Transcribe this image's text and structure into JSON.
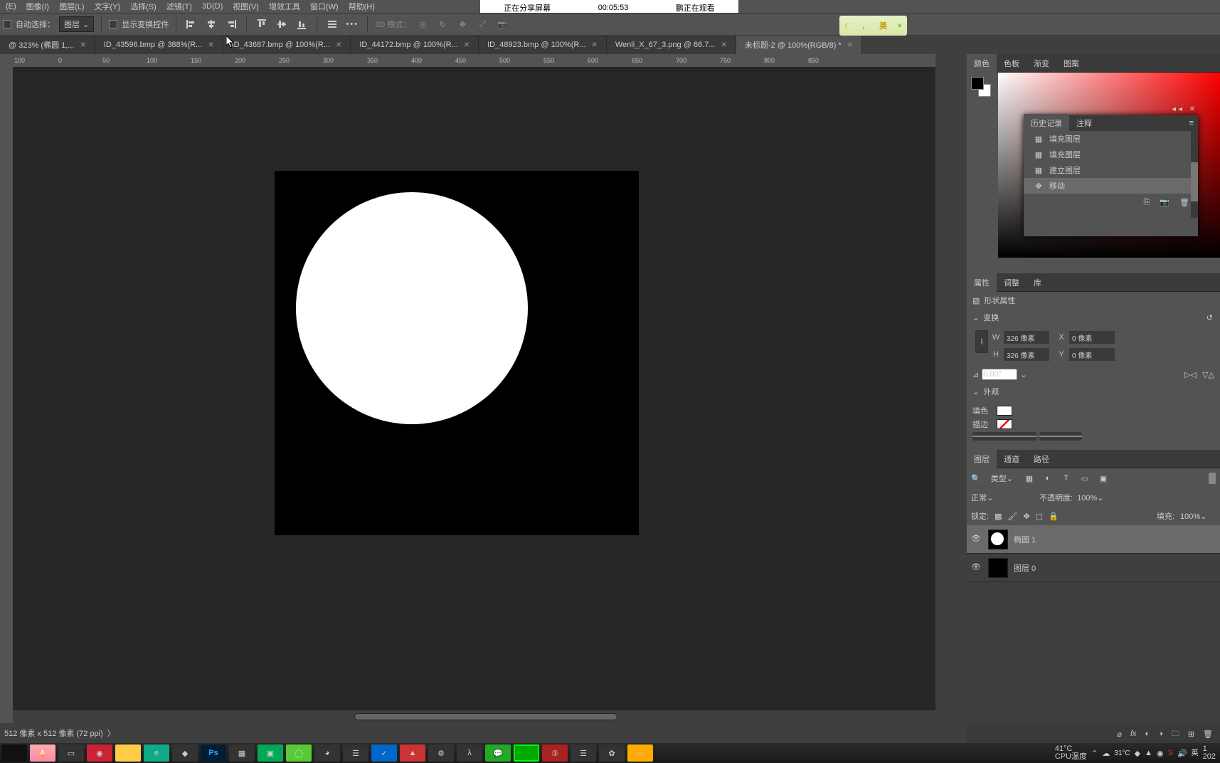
{
  "menu": [
    "(E)",
    "图像(I)",
    "图层(L)",
    "文字(Y)",
    "选择(S)",
    "滤镜(T)",
    "3D(D)",
    "视图(V)",
    "增效工具",
    "窗口(W)",
    "帮助(H)"
  ],
  "share": {
    "status": "正在分享屏幕",
    "time": "00:05:53",
    "viewer": "鹏正在观看"
  },
  "optbar": {
    "auto_select_label": "自动选择：",
    "auto_select_value": "图层",
    "show_transform_label": "显示变换控件",
    "mode3d_label": "3D 模式："
  },
  "tabs": [
    {
      "label": "@ 323% (椭圆 1,...",
      "active": false
    },
    {
      "label": "ID_43596.bmp @ 388%(R...",
      "active": false
    },
    {
      "label": "ID_43687.bmp @ 100%(R...",
      "active": false
    },
    {
      "label": "ID_44172.bmp @ 100%(R...",
      "active": false
    },
    {
      "label": "ID_48923.bmp @ 100%(R...",
      "active": false
    },
    {
      "label": "Wenli_X_67_3.png @ 66.7...",
      "active": false
    },
    {
      "label": "未标题-2 @ 100%(RGB/8) *",
      "active": true
    }
  ],
  "ruler_marks": [
    "100",
    "0",
    "50",
    "100",
    "150",
    "200",
    "250",
    "300",
    "350",
    "400",
    "450",
    "500",
    "550",
    "600",
    "650",
    "700",
    "750",
    "800",
    "850"
  ],
  "panel_tabs": {
    "color": [
      "颜色",
      "色板",
      "渐变",
      "图案"
    ],
    "history_float": {
      "tabs": [
        "历史记录",
        "注释"
      ],
      "items": [
        "填充图层",
        "填充图层",
        "建立图层",
        "移动"
      ],
      "selected": 3
    },
    "props": [
      "属性",
      "调整",
      "库"
    ],
    "layers": [
      "图层",
      "通道",
      "路径"
    ]
  },
  "props": {
    "title": "形状属性",
    "transform_label": "变换",
    "W": "326 像素",
    "H": "326 像素",
    "X": "0 像素",
    "Y": "0 像素",
    "angle": "0.00°",
    "appearance_label": "外观",
    "fill_label": "填色",
    "stroke_label": "描边"
  },
  "layers_panel": {
    "filter_label": "类型",
    "blend_mode": "正常",
    "opacity_label": "不透明度:",
    "opacity_value": "100%",
    "lock_label": "锁定:",
    "fill_label": "填充:",
    "fill_value": "100%",
    "layers": [
      {
        "name": "椭圆 1",
        "kind": "ellipse",
        "selected": true
      },
      {
        "name": "图层 0",
        "kind": "black",
        "selected": false
      }
    ]
  },
  "status": {
    "doc": "512 像素 x 512 像素 (72 ppi)"
  },
  "sys": {
    "gputemp": "41°C",
    "gpulabel": "CPU温度",
    "weather": "31°C",
    "ime": "英",
    "year": "202"
  }
}
